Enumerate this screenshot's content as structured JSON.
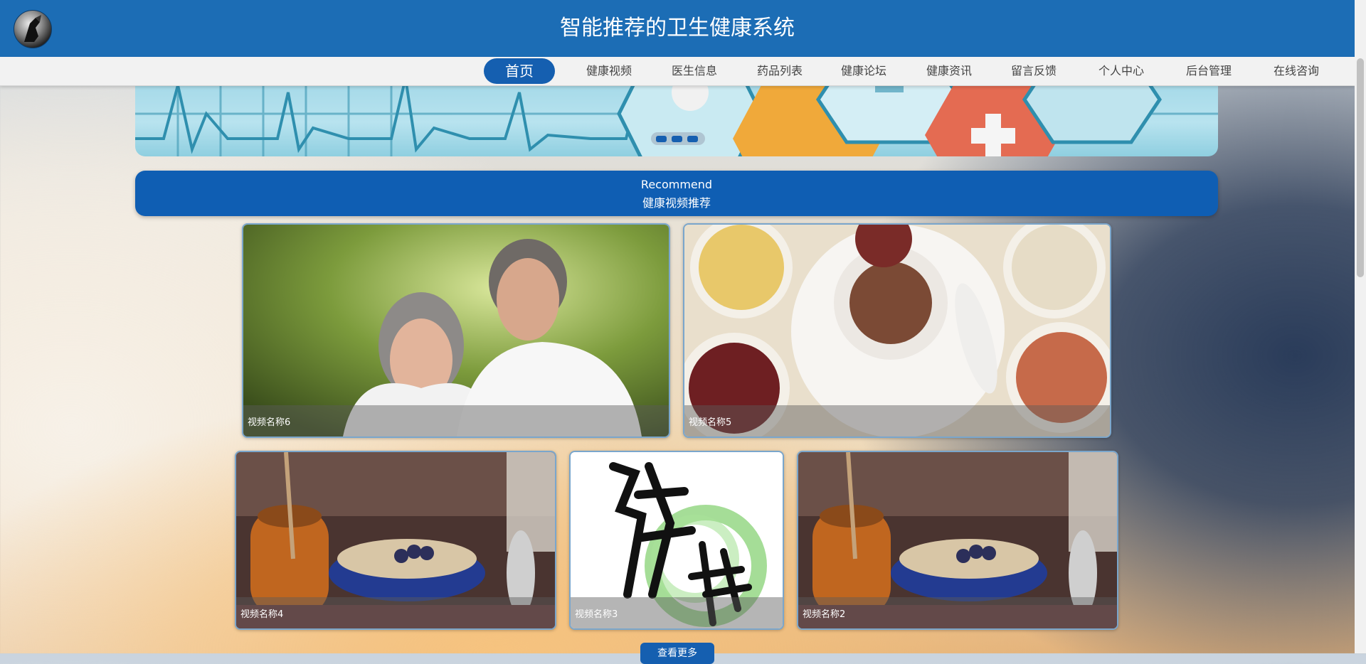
{
  "header": {
    "title": "智能推荐的卫生健康系统",
    "logo_icon": "avatar-logo-icon"
  },
  "nav": {
    "items": [
      {
        "label": "首页",
        "active": true
      },
      {
        "label": "健康视频"
      },
      {
        "label": "医生信息"
      },
      {
        "label": "药品列表"
      },
      {
        "label": "健康论坛"
      },
      {
        "label": "健康资讯"
      },
      {
        "label": "留言反馈"
      },
      {
        "label": "个人中心"
      },
      {
        "label": "后台管理"
      },
      {
        "label": "在线咨询"
      }
    ]
  },
  "banner": {
    "slide_count": 3,
    "active_slide": 1
  },
  "recommend": {
    "title_en": "Recommend",
    "title_cn": "健康视频推荐"
  },
  "videos": [
    {
      "name": "视频名称6",
      "thumbnail": "elderly-couple-photo"
    },
    {
      "name": "视频名称5",
      "thumbnail": "grains-porridge-photo"
    },
    {
      "name": "视频名称4",
      "thumbnail": "oatmeal-honey-photo"
    },
    {
      "name": "视频名称3",
      "thumbnail": "health-calligraphy-image"
    },
    {
      "name": "视频名称2",
      "thumbnail": "oatmeal-honey-photo"
    }
  ],
  "more_button": {
    "label": "查看更多"
  },
  "colors": {
    "primary": "#1c6db5",
    "nav_active": "#155fb0",
    "recommend_bar": "#0f5eb3"
  }
}
